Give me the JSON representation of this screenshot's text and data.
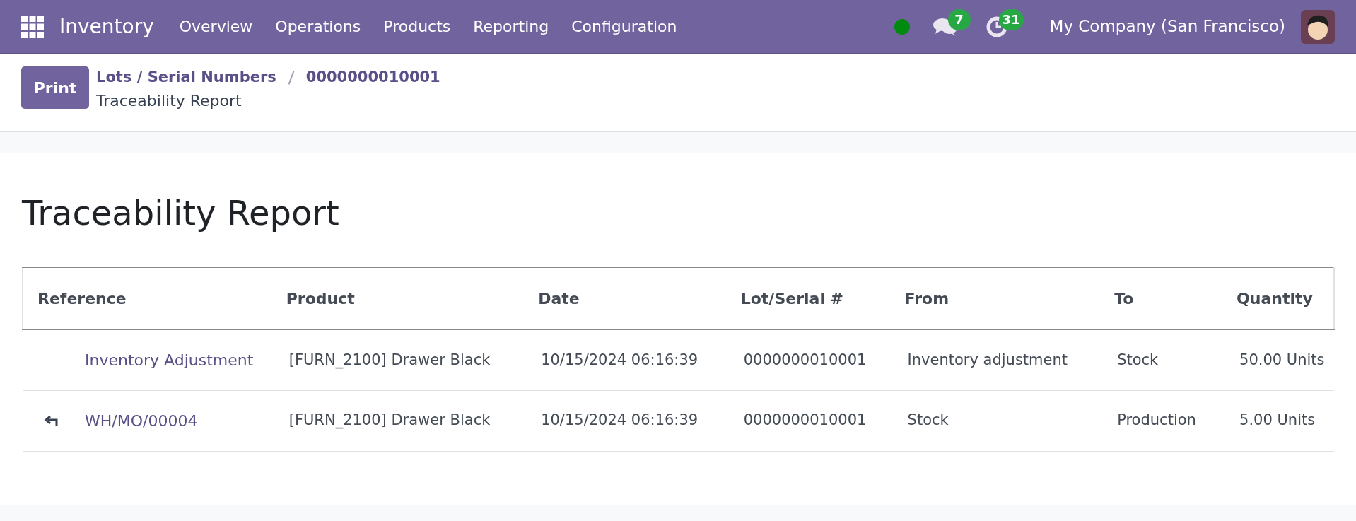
{
  "navbar": {
    "app": "Inventory",
    "menu": [
      "Overview",
      "Operations",
      "Products",
      "Reporting",
      "Configuration"
    ],
    "messages_count": "7",
    "activities_count": "31",
    "company": "My Company (San Francisco)"
  },
  "control_panel": {
    "print": "Print",
    "breadcrumb": [
      "Lots / Serial Numbers",
      "0000000010001"
    ],
    "subtitle": "Traceability Report"
  },
  "report": {
    "title": "Traceability Report",
    "table": {
      "columns": [
        "Reference",
        "Product",
        "Date",
        "Lot/Serial #",
        "From",
        "To",
        "Quantity"
      ],
      "rows": [
        {
          "upstream_arrow": false,
          "cells": [
            "Inventory Adjustment",
            "[FURN_2100] Drawer Black",
            "10/15/2024 06:16:39",
            "0000000010001",
            "Inventory adjustment",
            "Stock",
            "50.00 Units"
          ]
        },
        {
          "upstream_arrow": true,
          "cells": [
            "WH/MO/00004",
            "[FURN_2100] Drawer Black",
            "10/15/2024 06:16:39",
            "0000000010001",
            "Stock",
            "Production",
            "5.00 Units"
          ]
        }
      ]
    }
  }
}
